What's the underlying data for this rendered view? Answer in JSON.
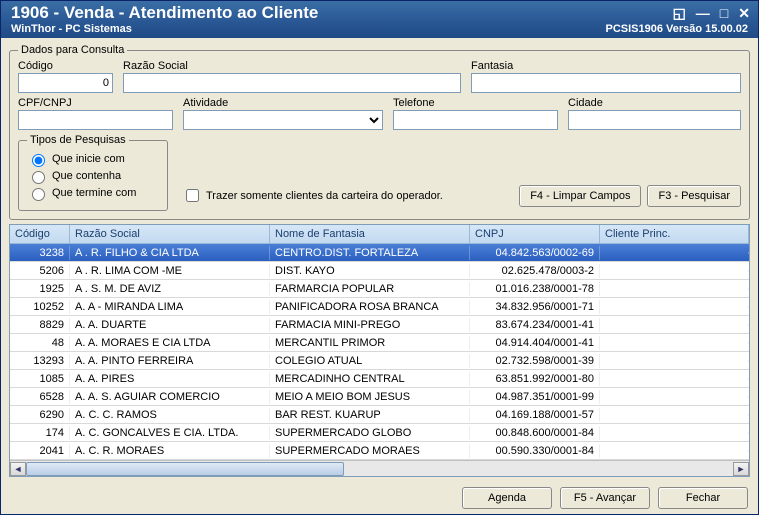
{
  "titlebar": {
    "title": "1906 - Venda - Atendimento ao Cliente",
    "subtitle": "WinThor - PC Sistemas",
    "version": "PCSIS1906     Versão 15.00.02"
  },
  "groupbox": {
    "legend": "Dados para Consulta",
    "fields": {
      "codigo_label": "Código",
      "codigo_value": "0",
      "razao_label": "Razão Social",
      "razao_value": "",
      "fantasia_label": "Fantasia",
      "fantasia_value": "",
      "cpf_label": "CPF/CNPJ",
      "cpf_value": "",
      "atividade_label": "Atividade",
      "atividade_value": "",
      "telefone_label": "Telefone",
      "telefone_value": "",
      "cidade_label": "Cidade",
      "cidade_value": ""
    },
    "tipos": {
      "legend": "Tipos de Pesquisas",
      "opt1": "Que inicie com",
      "opt2": "Que contenha",
      "opt3": "Que termine com"
    },
    "checkbox_label": "Trazer somente clientes da carteira do operador.",
    "btn_limpar": "F4 - Limpar Campos",
    "btn_pesquisar": "F3 - Pesquisar"
  },
  "grid": {
    "headers": {
      "codigo": "Código",
      "razao": "Razão Social",
      "nomef": "Nome de Fantasia",
      "cnpj": "CNPJ",
      "cli": "Cliente Princ."
    },
    "rows": [
      {
        "codigo": "3238",
        "razao": "A . R. FILHO & CIA LTDA",
        "nomef": "CENTRO.DIST. FORTALEZA",
        "cnpj": "04.842.563/0002-69",
        "cli": ""
      },
      {
        "codigo": "5206",
        "razao": "A . R. LIMA COM -ME",
        "nomef": "DIST. KAYO",
        "cnpj": "02.625.478/0003-2",
        "cli": ""
      },
      {
        "codigo": "1925",
        "razao": "A . S. M. DE AVIZ",
        "nomef": "FARMARCIA POPULAR",
        "cnpj": "01.016.238/0001-78",
        "cli": ""
      },
      {
        "codigo": "10252",
        "razao": "A. A - MIRANDA LIMA",
        "nomef": "PANIFICADORA ROSA BRANCA",
        "cnpj": "34.832.956/0001-71",
        "cli": ""
      },
      {
        "codigo": "8829",
        "razao": "A. A. DUARTE",
        "nomef": "FARMACIA MINI-PREGO",
        "cnpj": "83.674.234/0001-41",
        "cli": ""
      },
      {
        "codigo": "48",
        "razao": "A. A. MORAES E CIA LTDA",
        "nomef": "MERCANTIL PRIMOR",
        "cnpj": "04.914.404/0001-41",
        "cli": ""
      },
      {
        "codigo": "13293",
        "razao": "A. A. PINTO FERREIRA",
        "nomef": "COLEGIO ATUAL",
        "cnpj": "02.732.598/0001-39",
        "cli": ""
      },
      {
        "codigo": "1085",
        "razao": "A. A. PIRES",
        "nomef": "MERCADINHO CENTRAL",
        "cnpj": "63.851.992/0001-80",
        "cli": ""
      },
      {
        "codigo": "6528",
        "razao": "A. A. S. AGUIAR COMERCIO",
        "nomef": "MEIO A MEIO BOM JESUS",
        "cnpj": "04.987.351/0001-99",
        "cli": ""
      },
      {
        "codigo": "6290",
        "razao": "A. C. C. RAMOS",
        "nomef": "BAR REST. KUARUP",
        "cnpj": "04.169.188/0001-57",
        "cli": ""
      },
      {
        "codigo": "174",
        "razao": "A. C. GONCALVES E CIA. LTDA.",
        "nomef": "SUPERMERCADO GLOBO",
        "cnpj": "00.848.600/0001-84",
        "cli": ""
      },
      {
        "codigo": "2041",
        "razao": "A. C. R. MORAES",
        "nomef": "SUPERMERCADO MORAES",
        "cnpj": "00.590.330/0001-84",
        "cli": ""
      }
    ]
  },
  "footer": {
    "agenda": "Agenda",
    "avancar": "F5 - Avançar",
    "fechar": "Fechar"
  }
}
